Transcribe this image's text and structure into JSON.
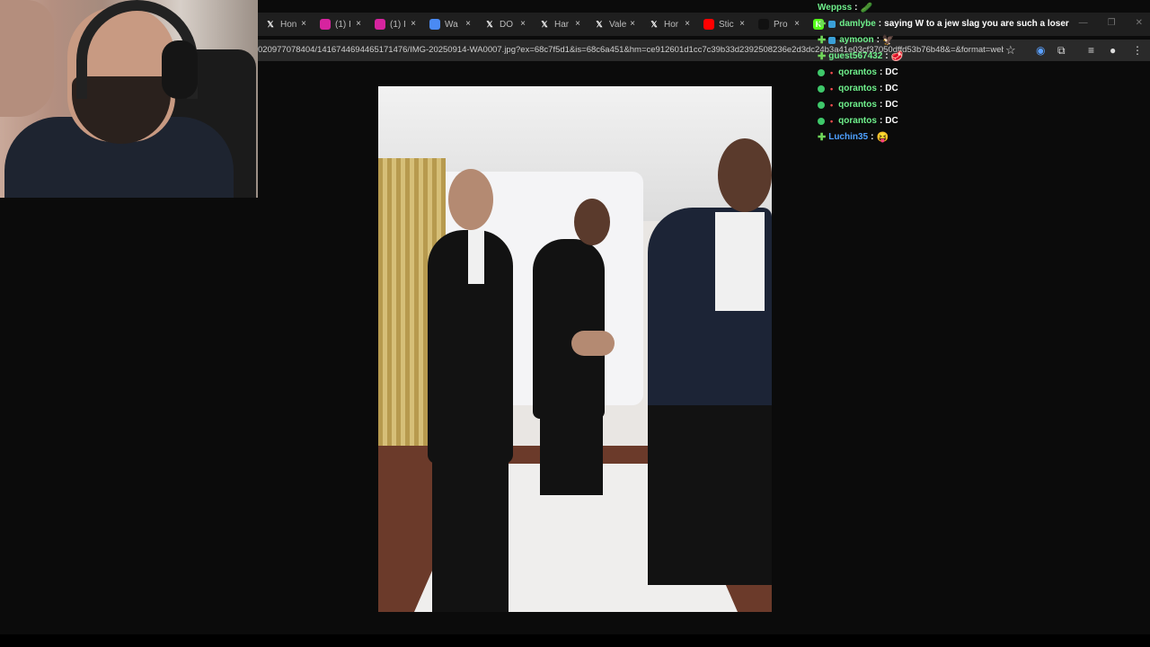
{
  "browser": {
    "tabs": [
      {
        "label": "Hon",
        "icon": "x-logo-icon",
        "color": "#1f1f1f"
      },
      {
        "label": "(1) I",
        "icon": "instagram-icon",
        "color": "#d6249f"
      },
      {
        "label": "(1) I",
        "icon": "instagram-icon",
        "color": "#d6249f"
      },
      {
        "label": "Wa",
        "icon": "web-icon",
        "color": "#4a8af4"
      },
      {
        "label": "DO",
        "icon": "x-logo-icon",
        "color": "#1f1f1f"
      },
      {
        "label": "Har",
        "icon": "x-logo-icon",
        "color": "#1f1f1f"
      },
      {
        "label": "Vale",
        "icon": "x-logo-icon",
        "color": "#1f1f1f"
      },
      {
        "label": "Hor",
        "icon": "x-logo-icon",
        "color": "#1f1f1f"
      },
      {
        "label": "Stic",
        "icon": "youtube-icon",
        "color": "#ff0000"
      },
      {
        "label": "Pro",
        "icon": "tiktok-icon",
        "color": "#111111"
      },
      {
        "label": "K",
        "icon": "kick-icon",
        "color": "#53fc18"
      }
    ],
    "close_glyph": "×",
    "url": "020977078404/1416744694465171476/IMG-20250914-WA0007.jpg?ex=68c7f5d1&is=68c6a451&hm=ce912601d1cc7c39b33d2392508236e2d3dc24b3a41e03cf37050dffd53b76b48&=&format=webp..."
  },
  "chat": [
    {
      "user": "Weppss",
      "message": "",
      "emoji": "🥒",
      "user_color": "green",
      "badges": []
    },
    {
      "user": "damlybe",
      "message": "saying W to a jew slag you are such a loser",
      "emoji": "",
      "user_color": "green",
      "badges": [
        "cross",
        "square"
      ]
    },
    {
      "user": "aymoon",
      "message": "",
      "emoji": "🦅",
      "user_color": "green",
      "badges": [
        "cross",
        "square"
      ]
    },
    {
      "user": "guest567432",
      "message": "",
      "emoji": "🥩",
      "user_color": "green",
      "badges": [
        "cross"
      ]
    },
    {
      "user": "qorantos",
      "message": "DC",
      "emoji": "",
      "user_color": "green",
      "badges": [
        "sub",
        "dot"
      ]
    },
    {
      "user": "qorantos",
      "message": "DC",
      "emoji": "",
      "user_color": "green",
      "badges": [
        "sub",
        "dot"
      ]
    },
    {
      "user": "qorantos",
      "message": "DC",
      "emoji": "",
      "user_color": "green",
      "badges": [
        "sub",
        "dot"
      ]
    },
    {
      "user": "qorantos",
      "message": "DC",
      "emoji": "",
      "user_color": "green",
      "badges": [
        "sub",
        "dot"
      ]
    },
    {
      "user": "Luchin35",
      "message": "",
      "emoji": "😝",
      "user_color": "blue",
      "badges": [
        "cross"
      ]
    }
  ],
  "colors": {
    "background": "#0b0b0b",
    "tab_strip": "#1f1f1f",
    "address_bar": "#2a2a2a",
    "chat_user_green": "#6ff08c",
    "chat_user_blue": "#4ea0ff"
  }
}
